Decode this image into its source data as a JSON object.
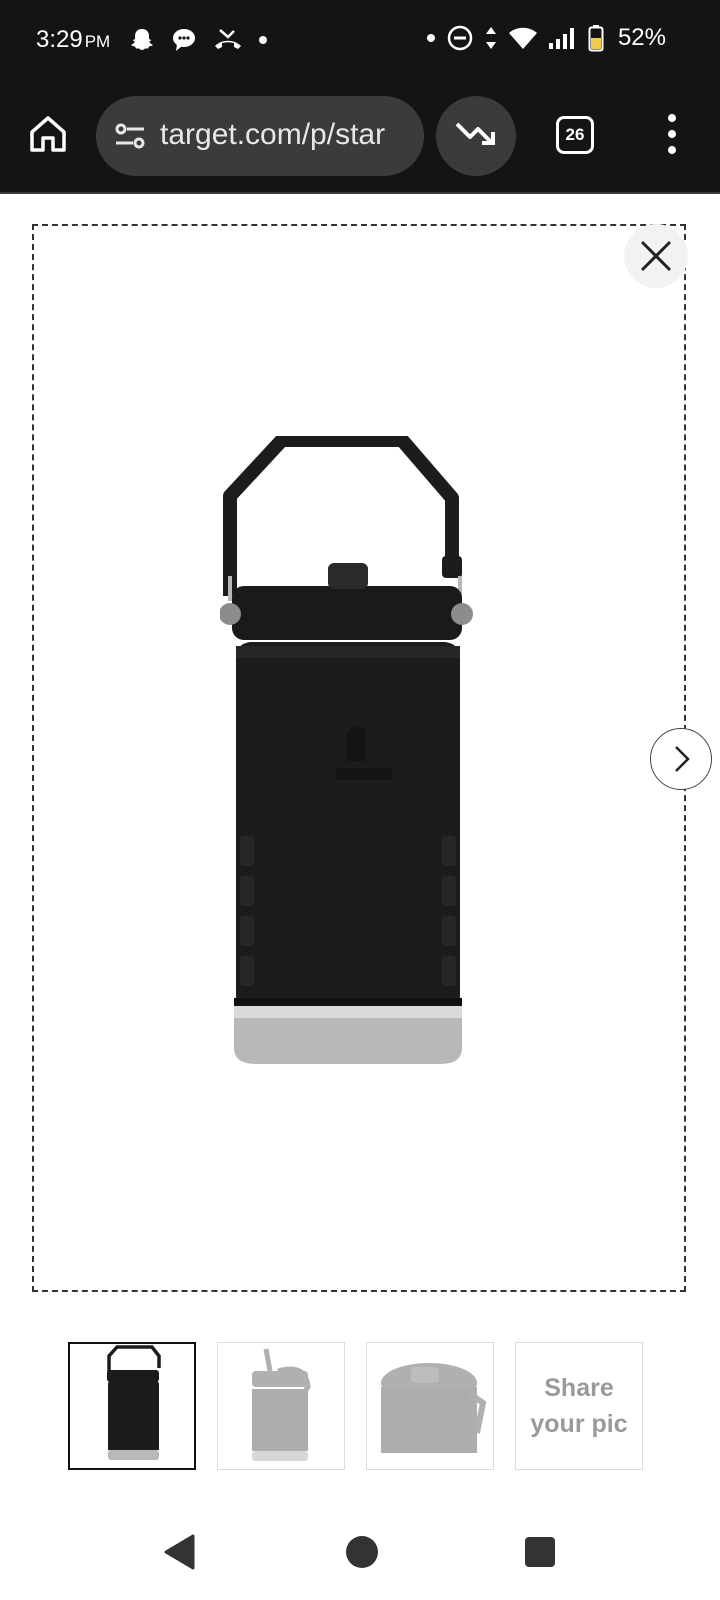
{
  "status_bar": {
    "time": "3:29",
    "ampm": "PM",
    "battery": "52%"
  },
  "browser": {
    "url": "target.com/p/star",
    "tab_count": "26"
  },
  "thumbnails": {
    "share_label_line1": "Share",
    "share_label_line2": "your pic"
  },
  "colors": {
    "status_bar_bg": "#141414",
    "url_pill_bg": "#3b3b3b",
    "product_black": "#1c1c1c",
    "steel": "#b8b8b8"
  },
  "icons": [
    "snapchat-icon",
    "chat-bubble-icon",
    "missed-call-icon",
    "dnd-icon",
    "data-arrows-icon",
    "wifi-icon",
    "signal-icon",
    "battery-icon",
    "home-icon",
    "tune-icon",
    "trending-icon",
    "tabs-icon",
    "more-vert-icon",
    "close-icon",
    "chevron-right-icon",
    "nav-back-icon",
    "nav-home-icon",
    "nav-recents-icon"
  ]
}
